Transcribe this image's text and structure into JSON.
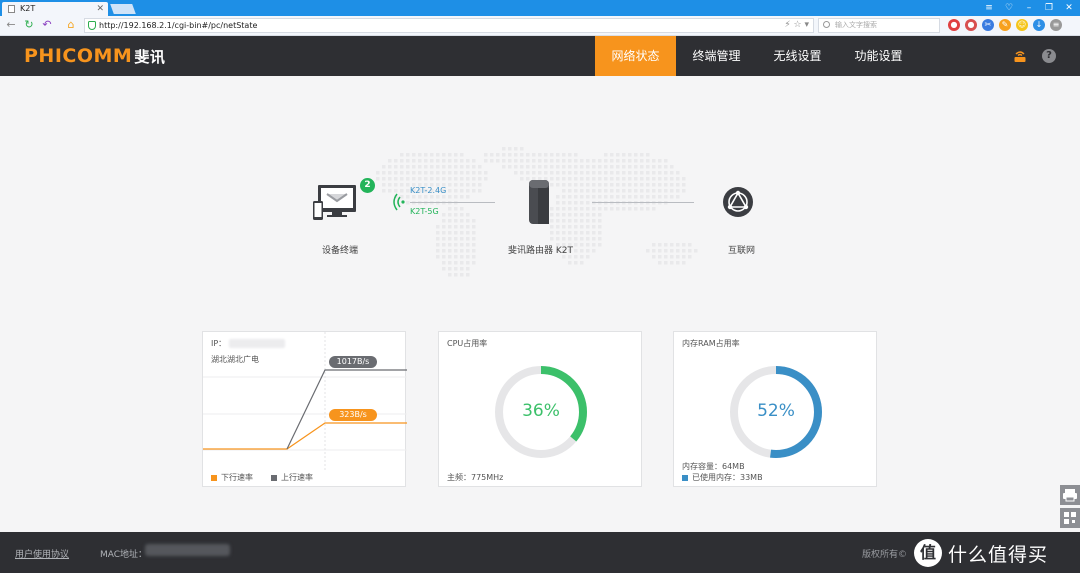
{
  "browser": {
    "tab_title": "K2T",
    "url": "http://192.168.2.1/cgi-bin#/pc/netState",
    "search_placeholder": "输入文字搜索"
  },
  "header": {
    "logo": "PHICOMM",
    "logo_cn": "斐讯",
    "nav": [
      {
        "label": "网络状态",
        "active": true
      },
      {
        "label": "终端管理",
        "active": false
      },
      {
        "label": "无线设置",
        "active": false
      },
      {
        "label": "功能设置",
        "active": false
      }
    ],
    "help_icon": "?"
  },
  "topology": {
    "device_label": "设备终端",
    "device_count": "2",
    "band_24": "K2T-2.4G",
    "band_5": "K2T-5G",
    "router_label": "斐讯路由器 K2T",
    "internet_label": "互联网"
  },
  "traffic_card": {
    "ip_label": "IP：",
    "isp": "湖北湖北广电",
    "upload_speed": "1017B/s",
    "download_speed": "323B/s",
    "legend_down": "下行速率",
    "legend_up": "上行速率"
  },
  "cpu_card": {
    "title": "CPU占用率",
    "percent": 36,
    "percent_text": "36%",
    "freq": "主频：775MHz",
    "color": "#3cc06a"
  },
  "ram_card": {
    "title": "内存RAM占用率",
    "percent": 52,
    "percent_text": "52%",
    "capacity": "内存容量：64MB",
    "used": "已使用内存：33MB",
    "color": "#3a8fc6"
  },
  "footer": {
    "agreement": "用户使用协议",
    "mac_label": "MAC地址：",
    "copyright": "版权所有©",
    "watermark_logo": "值",
    "watermark_text": "什么值得买"
  }
}
